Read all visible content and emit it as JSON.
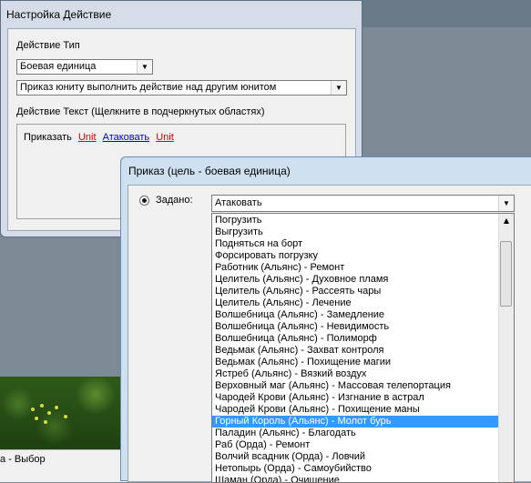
{
  "status_bar": {
    "text": "а - Выбор"
  },
  "window1": {
    "title": "Настройка Действие",
    "action_type_label": "Действие Тип",
    "type_combo_value": "Боевая единица",
    "action_combo_value": "Приказ юниту выполнить действие над другим юнитом",
    "action_text_label": "Действие Текст (Щелкните в подчеркнутых областях)",
    "text_parts": [
      "Приказать",
      "Unit",
      "Атаковать",
      "Unit"
    ]
  },
  "window2": {
    "title": "Приказ (цель - боевая единица)",
    "radio_label": "Задано:",
    "combo_value": "Атаковать",
    "list_items": [
      "Погрузить",
      "Выгрузить",
      "Подняться на борт",
      "Форсировать погрузку",
      "Работник (Альянс) - Ремонт",
      "Целитель (Альянс) - Духовное пламя",
      "Целитель (Альянс) - Рассеять чары",
      "Целитель (Альянс) - Лечение",
      "Волшебница (Альянс) - Замедление",
      "Волшебница (Альянс) - Невидимость",
      "Волшебница (Альянс) - Полиморф",
      "Ведьмак (Альянс) - Захват контроля",
      "Ведьмак (Альянс) - Похищение магии",
      "Ястреб (Альянс) - Вязкий воздух",
      "Верховный маг (Альянс) - Массовая телепортация",
      "Чародей Крови (Альянс) - Изгнание в астрал",
      "Чародей Крови (Альянс) - Похищение маны",
      "Горный Король (Альянс) - Молот бурь",
      "Паладин (Альянс) - Благодать",
      "Раб (Орда) - Ремонт",
      "Волчий всадник (Орда) - Ловчий",
      "Нетопырь (Орда) - Самоубийство",
      "Шаман (Орда) - Очищение"
    ],
    "selected_index": 17
  }
}
